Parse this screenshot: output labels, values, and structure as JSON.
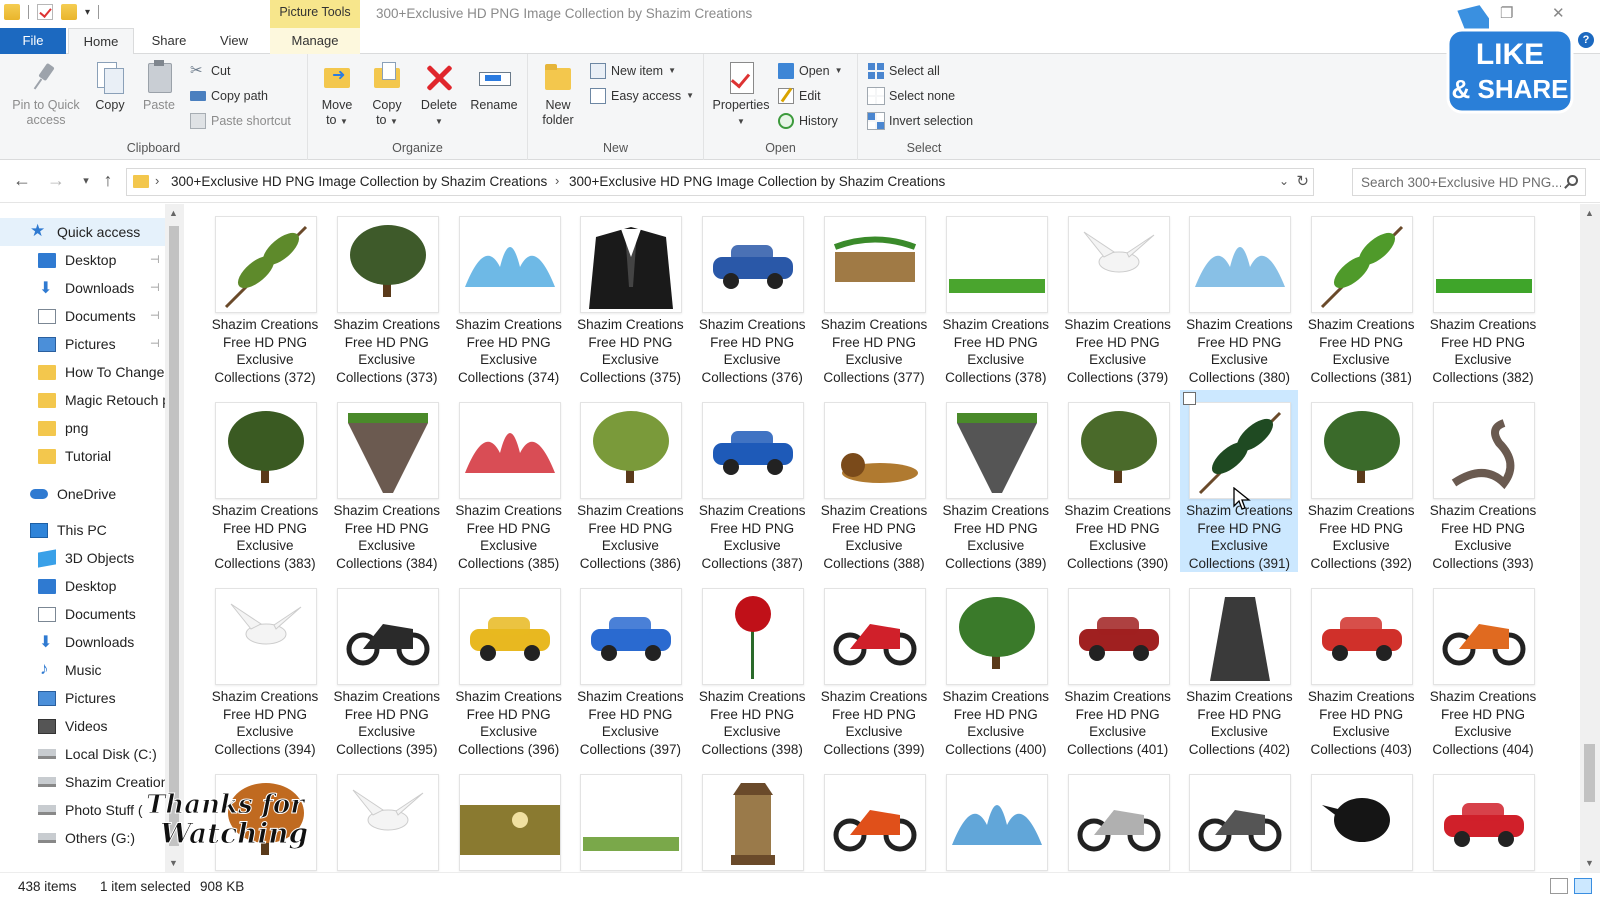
{
  "titlebar": {
    "context_tab": "Picture Tools",
    "title": "300+Exclusive HD PNG Image Collection by Shazim Creations"
  },
  "tabs": [
    "File",
    "Home",
    "Share",
    "View",
    "Manage"
  ],
  "ribbon": {
    "clipboard": {
      "label": "Clipboard",
      "pin_to_quick_access_line1": "Pin to Quick",
      "pin_to_quick_access_line2": "access",
      "copy": "Copy",
      "paste": "Paste",
      "cut": "Cut",
      "copy_path": "Copy path",
      "paste_shortcut": "Paste shortcut"
    },
    "organize": {
      "label": "Organize",
      "move_to_line1": "Move",
      "move_to_line2": "to",
      "copy_to_line1": "Copy",
      "copy_to_line2": "to",
      "delete": "Delete",
      "rename": "Rename"
    },
    "new": {
      "label": "New",
      "new_folder_line1": "New",
      "new_folder_line2": "folder",
      "new_item": "New item",
      "easy_access": "Easy access"
    },
    "open": {
      "label": "Open",
      "properties": "Properties",
      "open": "Open",
      "edit": "Edit",
      "history": "History"
    },
    "select": {
      "label": "Select",
      "select_all": "Select all",
      "select_none": "Select none",
      "invert_selection": "Invert selection"
    }
  },
  "address": {
    "crumbs": [
      "300+Exclusive HD PNG Image Collection by Shazim Creations",
      "300+Exclusive HD PNG Image Collection by Shazim Creations"
    ]
  },
  "search": {
    "placeholder": "Search 300+Exclusive HD PNG..."
  },
  "navpane": {
    "items": [
      {
        "label": "Quick access",
        "icon": "star-icon",
        "pinned": false
      },
      {
        "label": "Desktop",
        "icon": "desktop-icon",
        "pinned": true
      },
      {
        "label": "Downloads",
        "icon": "download-icon",
        "pinned": true
      },
      {
        "label": "Documents",
        "icon": "documents-icon",
        "pinned": true
      },
      {
        "label": "Pictures",
        "icon": "pictures-icon",
        "pinned": true
      },
      {
        "label": "How To Change",
        "icon": "folder-icon",
        "pinned": false
      },
      {
        "label": "Magic Retouch p",
        "icon": "folder-icon",
        "pinned": false
      },
      {
        "label": "png",
        "icon": "folder-icon",
        "pinned": false
      },
      {
        "label": "Tutorial",
        "icon": "folder-icon",
        "pinned": false
      },
      {
        "label": "OneDrive",
        "icon": "cloud-icon",
        "pinned": false
      },
      {
        "label": "This PC",
        "icon": "computer-icon",
        "pinned": false
      },
      {
        "label": "3D Objects",
        "icon": "3d-objects-icon",
        "pinned": false
      },
      {
        "label": "Desktop",
        "icon": "desktop-icon",
        "pinned": false
      },
      {
        "label": "Documents",
        "icon": "documents-icon",
        "pinned": false
      },
      {
        "label": "Downloads",
        "icon": "download-icon",
        "pinned": false
      },
      {
        "label": "Music",
        "icon": "music-icon",
        "pinned": false
      },
      {
        "label": "Pictures",
        "icon": "pictures-icon",
        "pinned": false
      },
      {
        "label": "Videos",
        "icon": "videos-icon",
        "pinned": false
      },
      {
        "label": "Local Disk (C:)",
        "icon": "disk-icon",
        "pinned": false
      },
      {
        "label": "Shazim Creation",
        "icon": "disk-icon",
        "pinned": false
      },
      {
        "label": "Photo Stuff (",
        "icon": "disk-icon",
        "pinned": false
      },
      {
        "label": "Others (G:)",
        "icon": "disk-icon",
        "pinned": false
      }
    ]
  },
  "files": {
    "label_line1": "Shazim Creations",
    "label_line2": "Free HD PNG",
    "label_line3": "Exclusive",
    "items": [
      {
        "name": "Collections (372)",
        "subject": "pine-branch",
        "color": "#5e8a2b"
      },
      {
        "name": "Collections (373)",
        "subject": "tree-overhang",
        "color": "#3e5a2a"
      },
      {
        "name": "Collections (374)",
        "subject": "water-splash",
        "color": "#4aa8e0"
      },
      {
        "name": "Collections (375)",
        "subject": "black-suit",
        "color": "#1a1a1a"
      },
      {
        "name": "Collections (376)",
        "subject": "blue-car-road",
        "color": "#2a58a8"
      },
      {
        "name": "Collections (377)",
        "subject": "wooden-sign-vines",
        "color": "#a07a45"
      },
      {
        "name": "Collections (378)",
        "subject": "grass-strip",
        "color": "#4aa52e"
      },
      {
        "name": "Collections (379)",
        "subject": "white-dove",
        "color": "#e8e8e8"
      },
      {
        "name": "Collections (380)",
        "subject": "water-splash",
        "color": "#6ab0e0"
      },
      {
        "name": "Collections (381)",
        "subject": "green-leaves",
        "color": "#4f9a2a"
      },
      {
        "name": "Collections (382)",
        "subject": "grass-tuft",
        "color": "#3fa52a"
      },
      {
        "name": "Collections (383)",
        "subject": "palm-trees",
        "color": "#3a5a22"
      },
      {
        "name": "Collections (384)",
        "subject": "floating-rock",
        "color": "#6b5a50"
      },
      {
        "name": "Collections (385)",
        "subject": "red-paint-splash",
        "color": "#d0202a"
      },
      {
        "name": "Collections (386)",
        "subject": "bush",
        "color": "#7a9a3a"
      },
      {
        "name": "Collections (387)",
        "subject": "blue-sedan",
        "color": "#1e5ab8"
      },
      {
        "name": "Collections (388)",
        "subject": "lion",
        "color": "#b07a30"
      },
      {
        "name": "Collections (389)",
        "subject": "floating-island",
        "color": "#555555"
      },
      {
        "name": "Collections (390)",
        "subject": "tree-canopy",
        "color": "#4a6a2a"
      },
      {
        "name": "Collections (391)",
        "subject": "pine-branch-dark",
        "color": "#1f4a22"
      },
      {
        "name": "Collections (392)",
        "subject": "bonsai-tree",
        "color": "#3a6a2a"
      },
      {
        "name": "Collections (393)",
        "subject": "snake",
        "color": "#6a5a50"
      },
      {
        "name": "Collections (394)",
        "subject": "white-dove",
        "color": "#dcdcdc"
      },
      {
        "name": "Collections (395)",
        "subject": "motorcycle-black",
        "color": "#2a2a2a"
      },
      {
        "name": "Collections (396)",
        "subject": "yellow-car",
        "color": "#e8b820"
      },
      {
        "name": "Collections (397)",
        "subject": "blue-convertible",
        "color": "#2a6ad0"
      },
      {
        "name": "Collections (398)",
        "subject": "red-rose",
        "color": "#c01018"
      },
      {
        "name": "Collections (399)",
        "subject": "red-sportbike",
        "color": "#d0202a"
      },
      {
        "name": "Collections (400)",
        "subject": "green-tree",
        "color": "#3a7a2a"
      },
      {
        "name": "Collections (401)",
        "subject": "vintage-red-car",
        "color": "#a02020"
      },
      {
        "name": "Collections (402)",
        "subject": "stone-stairs",
        "color": "#3a3a3a"
      },
      {
        "name": "Collections (403)",
        "subject": "red-sports-car",
        "color": "#d0302a"
      },
      {
        "name": "Collections (404)",
        "subject": "orange-sportbike",
        "color": "#e06a20"
      },
      {
        "name": "",
        "subject": "autumn-tree",
        "color": "#c06a20"
      },
      {
        "name": "",
        "subject": "white-dove",
        "color": "#e0e0e0"
      },
      {
        "name": "",
        "subject": "sunset-landscape",
        "color": "#8a7a30"
      },
      {
        "name": "",
        "subject": "flower-strip",
        "color": "#7aa84a"
      },
      {
        "name": "",
        "subject": "lantern",
        "color": "#6a4a2a"
      },
      {
        "name": "",
        "subject": "orange-sportbike",
        "color": "#e0501a"
      },
      {
        "name": "",
        "subject": "water-wave",
        "color": "#3a90d0"
      },
      {
        "name": "",
        "subject": "white-sportbike",
        "color": "#b0b0b0"
      },
      {
        "name": "",
        "subject": "grey-sportbike",
        "color": "#555555"
      },
      {
        "name": "",
        "subject": "crow",
        "color": "#151515"
      },
      {
        "name": "",
        "subject": "red-sports-car",
        "color": "#d0202a"
      }
    ],
    "selected_index": 19
  },
  "status": {
    "item_count": "438 items",
    "selection": "1 item selected",
    "size": "908 KB"
  },
  "overlays": {
    "like_line1": "LIKE",
    "like_line2": "& SHARE",
    "thanks_line1": "Thanks for",
    "thanks_line2": "Watching"
  },
  "colors": {
    "accent": "#1c69c0",
    "selection": "#cce8ff",
    "picture_tools": "#f7e68c"
  }
}
